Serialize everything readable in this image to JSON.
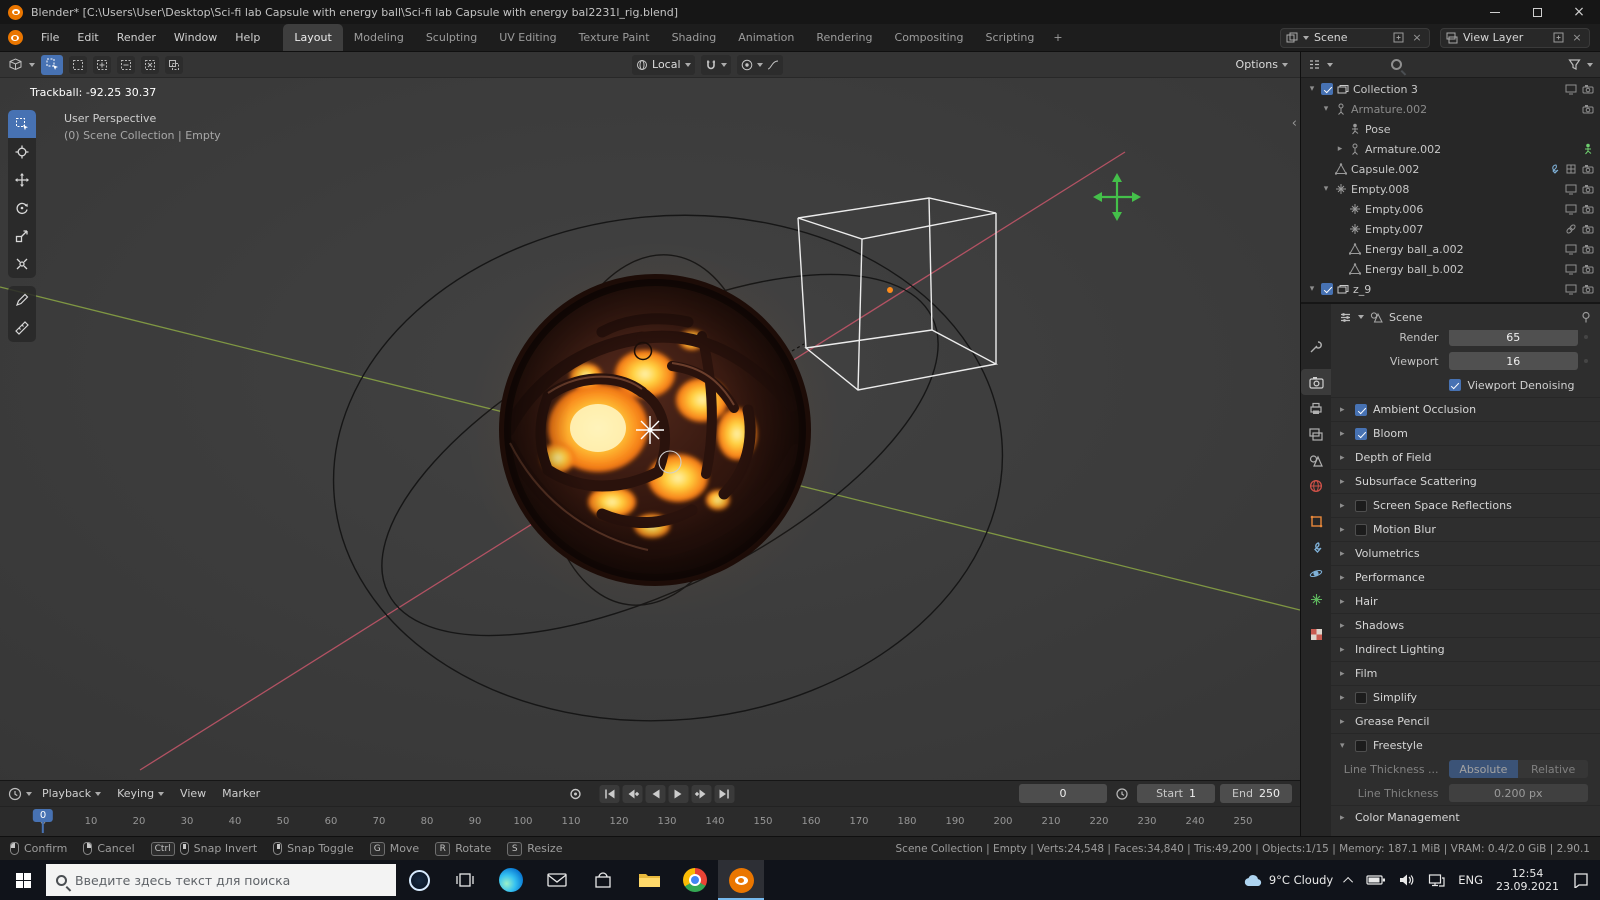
{
  "window": {
    "title": "Blender* [C:\\Users\\User\\Desktop\\Sci-fi lab Capsule with energy ball\\Sci-fi lab Capsule with energy bal2231l_rig.blend]"
  },
  "topbar": {
    "menus": [
      "File",
      "Edit",
      "Render",
      "Window",
      "Help"
    ],
    "workspaces": [
      "Layout",
      "Modeling",
      "Sculpting",
      "UV Editing",
      "Texture Paint",
      "Shading",
      "Animation",
      "Rendering",
      "Compositing",
      "Scripting"
    ],
    "add_workspace": "+",
    "scene": "Scene",
    "view_layer": "View Layer"
  },
  "viewport": {
    "orientation": "Local",
    "options": "Options",
    "operator_hint": "Trackball: -92.25 30.37",
    "view_label": "User Perspective",
    "context_label": "(0) Scene Collection | Empty",
    "collapse_glyph": "‹"
  },
  "outliner": {
    "rows": [
      {
        "label": "Collection 3"
      },
      {
        "label": "Armature.002"
      },
      {
        "label": "Pose"
      },
      {
        "label": "Armature.002"
      },
      {
        "label": "Capsule.002"
      },
      {
        "label": "Empty.008"
      },
      {
        "label": "Empty.006"
      },
      {
        "label": "Empty.007"
      },
      {
        "label": "Energy ball_a.002"
      },
      {
        "label": "Energy ball_b.002"
      },
      {
        "label": "z_9"
      }
    ]
  },
  "properties": {
    "breadcrumb": "Scene",
    "render_label": "Render",
    "render_value": "65",
    "viewport_label": "Viewport",
    "viewport_value": "16",
    "denoising_label": "Viewport Denoising",
    "sections": [
      "Ambient Occlusion",
      "Bloom",
      "Depth of Field",
      "Subsurface Scattering",
      "Screen Space Reflections",
      "Motion Blur",
      "Volumetrics",
      "Performance",
      "Hair",
      "Shadows",
      "Indirect Lighting",
      "Film",
      "Simplify",
      "Grease Pencil",
      "Freestyle"
    ],
    "line_thickness_mode_label": "Line Thickness ...",
    "absolute": "Absolute",
    "relative": "Relative",
    "line_thickness_label": "Line Thickness",
    "line_thickness_value": "0.200 px",
    "color_management": "Color Management"
  },
  "timeline": {
    "menus": [
      "Playback",
      "Keying",
      "View",
      "Marker"
    ],
    "current_frame": "0",
    "start_label": "Start",
    "start_value": "1",
    "end_label": "End",
    "end_value": "250",
    "playhead": "0",
    "ruler": [
      "0",
      "10",
      "20",
      "30",
      "40",
      "50",
      "60",
      "70",
      "80",
      "90",
      "100",
      "110",
      "120",
      "130",
      "140",
      "150",
      "160",
      "170",
      "180",
      "190",
      "200",
      "210",
      "220",
      "230",
      "240",
      "250"
    ]
  },
  "statusbar": {
    "hints": [
      {
        "key": "",
        "label": "Confirm"
      },
      {
        "key": "",
        "label": "Cancel"
      },
      {
        "key": "Ctrl",
        "label": "Snap Invert"
      },
      {
        "key": "",
        "label": "Snap Toggle"
      },
      {
        "key": "G",
        "label": "Move"
      },
      {
        "key": "R",
        "label": "Rotate"
      },
      {
        "key": "S",
        "label": "Resize"
      }
    ],
    "stats": "Scene Collection | Empty | Verts:24,548 | Faces:34,840 | Tris:49,200 | Objects:1/15 | Memory: 187.1 MiB | VRAM: 0.4/2.0 GiB | 2.90.1"
  },
  "taskbar": {
    "search_placeholder": "Введите здесь текст для поиска",
    "weather": "9°C Cloudy",
    "language": "ENG",
    "time": "12:54",
    "date": "23.09.2021"
  },
  "colors": {
    "accent_blue": "#4772b3",
    "blender_orange": "#ea7600"
  }
}
